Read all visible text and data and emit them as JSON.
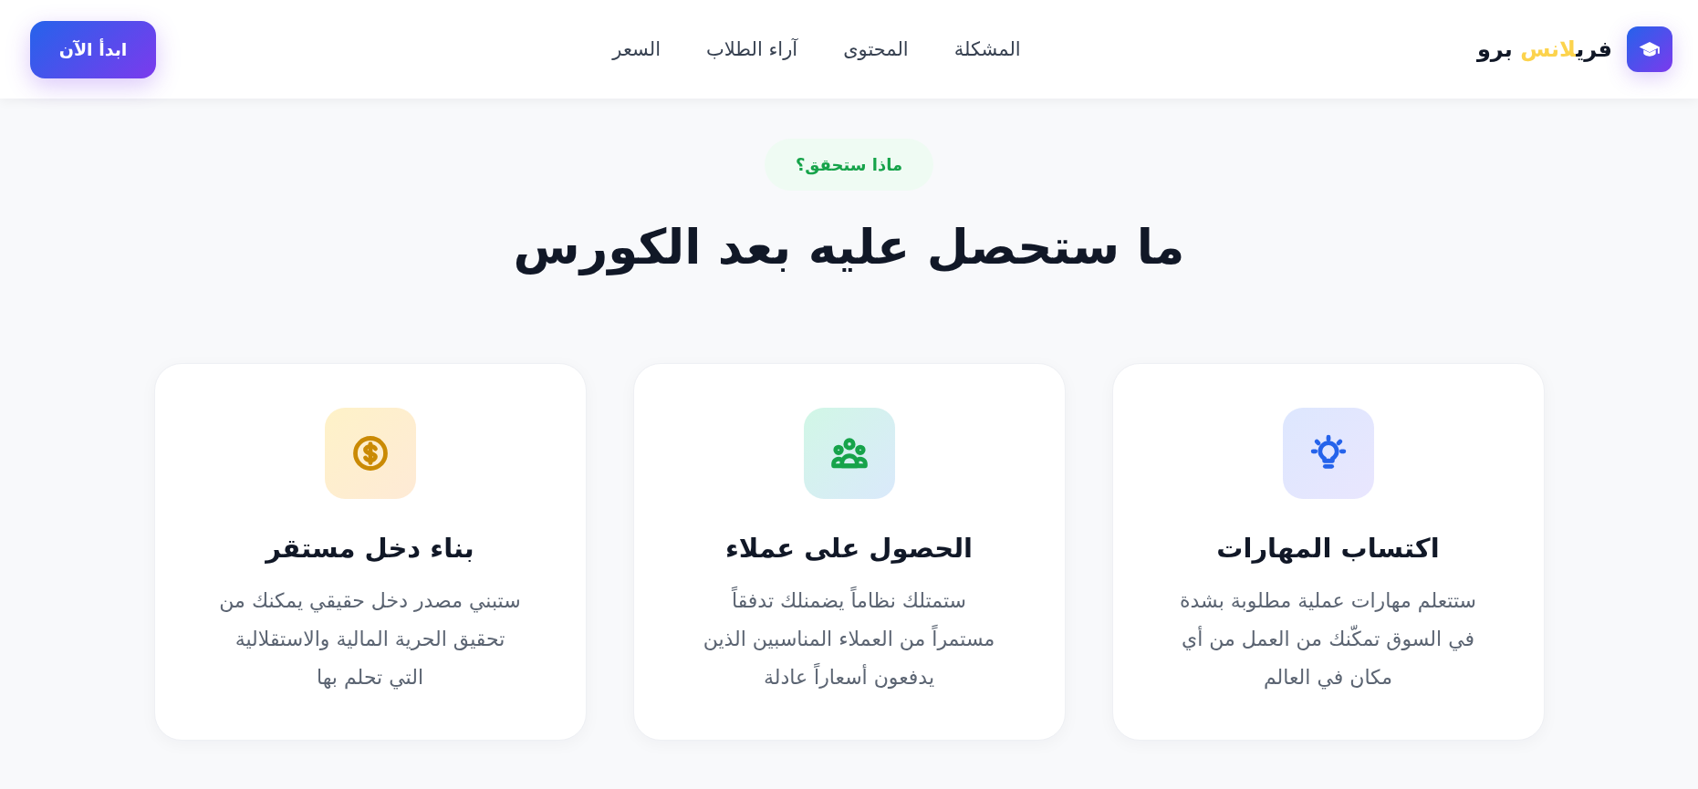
{
  "header": {
    "logo": {
      "parts": [
        {
          "text": "فري",
          "highlight": false
        },
        {
          "text": "لانس",
          "highlight": true
        },
        {
          "text": " برو",
          "highlight": false
        }
      ]
    },
    "nav": [
      "المشكلة",
      "المحتوى",
      "آراء الطلاب",
      "السعر"
    ],
    "cta": "ابدأ الآن"
  },
  "section": {
    "badge": "ماذا ستحقق؟",
    "title": "ما ستحصل عليه بعد الكورس",
    "cards": [
      {
        "kind": "bulb",
        "color": "#2563eb",
        "title": "اكتساب المهارات",
        "text": "ستتعلم مهارات عملية مطلوبة بشدة\nفي السوق تمكّنك من العمل من أي\nمكان في العالم"
      },
      {
        "kind": "people",
        "color": "#16a34a",
        "title": "الحصول على عملاء",
        "text": "ستمتلك نظاماً يضمنلك تدفقاً\nمستمراً من العملاء المناسبين الذين\nيدفعون أسعاراً عادلة"
      },
      {
        "kind": "dollar",
        "color": "#ca8a04",
        "title": "بناء دخل مستقر",
        "text": "ستبني مصدر دخل حقيقي يمكنك من\nتحقيق الحرية المالية والاستقلالية\nالتي تحلم بها"
      }
    ]
  }
}
